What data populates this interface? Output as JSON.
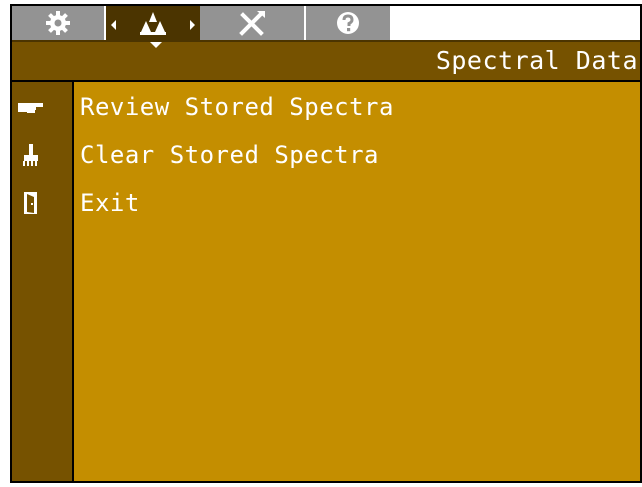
{
  "header": {
    "title": "Spectral Data"
  },
  "tabs": [
    {
      "icon": "gear-icon"
    },
    {
      "icon": "spectrum-icon",
      "active": true
    },
    {
      "icon": "tools-icon"
    },
    {
      "icon": "help-icon"
    }
  ],
  "menu": {
    "items": [
      {
        "label": "Review Stored Spectra",
        "icon": "pointing-hand-icon"
      },
      {
        "label": "Clear Stored Spectra",
        "icon": "broom-icon"
      },
      {
        "label": "Exit",
        "icon": "exit-door-icon"
      }
    ]
  },
  "colors": {
    "tab_gray": "#939393",
    "tab_active": "#4b3400",
    "header_bg": "#765200",
    "menu_bg": "#c48e00",
    "text": "#ffffff"
  }
}
